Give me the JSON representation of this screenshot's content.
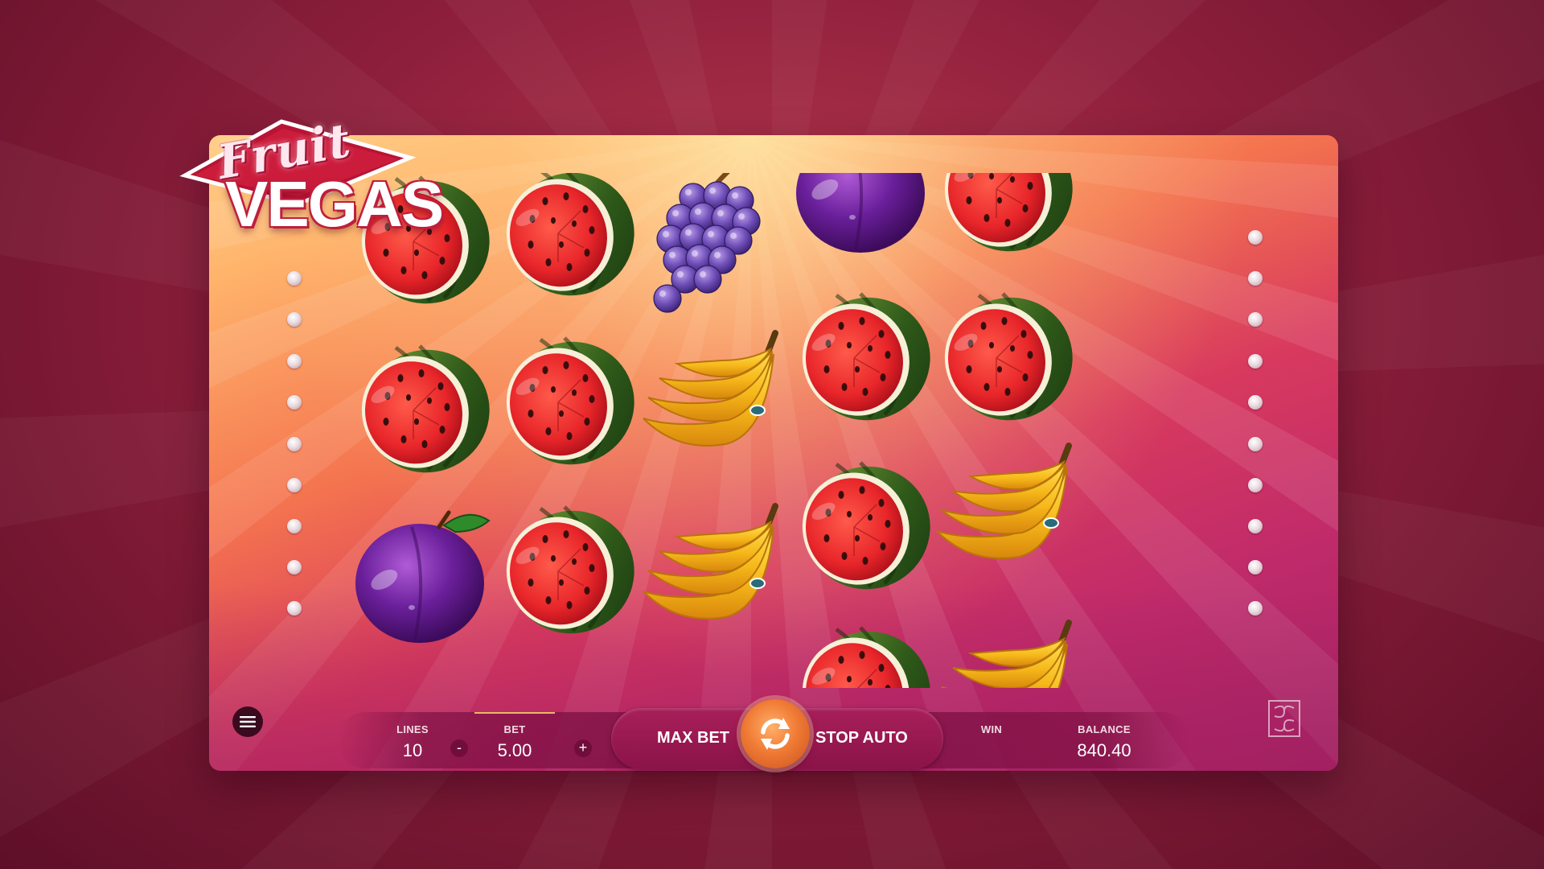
{
  "game": {
    "logo_word_1": "Fruit",
    "logo_word_2": "VEGAS"
  },
  "reels": [
    [
      "watermelon",
      "watermelon",
      "plum"
    ],
    [
      "watermelon",
      "watermelon",
      "watermelon"
    ],
    [
      "grapes",
      "banana",
      "banana"
    ],
    [
      "plum",
      "watermelon",
      "watermelon",
      "watermelon"
    ],
    [
      "watermelon",
      "watermelon",
      "banana",
      "banana"
    ]
  ],
  "controls": {
    "lines_label": "LINES",
    "lines_value": "10",
    "minus_label": "-",
    "bet_label": "BET",
    "bet_value": "5.00",
    "plus_label": "+",
    "max_bet_label": "MAX BET",
    "stop_auto_label": "STOP AUTO",
    "win_label": "WIN",
    "win_value": "",
    "balance_label": "BALANCE",
    "balance_value": "840.40"
  },
  "icons": {
    "menu": "hamburger-menu-icon",
    "spin": "refresh-arrows-icon",
    "provider": "provider-logo-icon"
  },
  "colors": {
    "background": "#8e1f3c",
    "spin_button": "#f07b35",
    "bar": "#8a1348"
  }
}
